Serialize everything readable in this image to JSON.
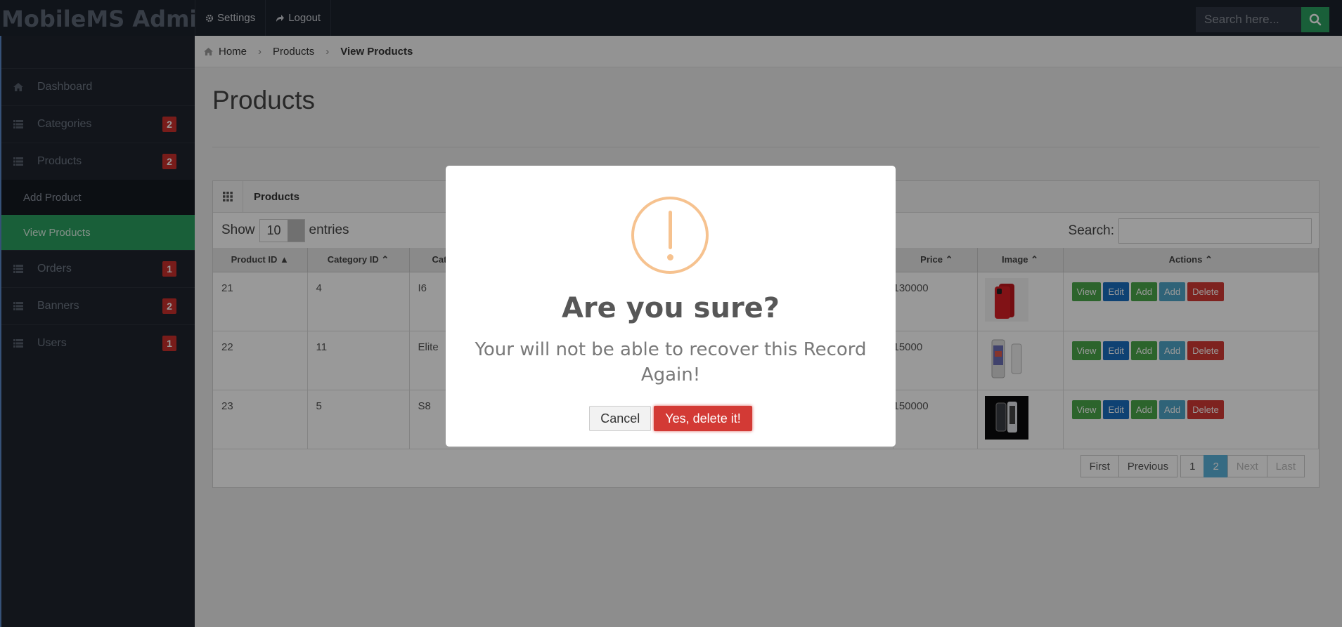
{
  "header": {
    "brand": "MobileMS Admin",
    "settings": "Settings",
    "logout": "Logout",
    "search_placeholder": "Search here..."
  },
  "sidebar": {
    "items": [
      {
        "label": "Dashboard"
      },
      {
        "label": "Categories",
        "badge": "2"
      },
      {
        "label": "Products",
        "badge": "2"
      },
      {
        "label": "Orders",
        "badge": "1"
      },
      {
        "label": "Banners",
        "badge": "2"
      },
      {
        "label": "Users",
        "badge": "1"
      }
    ],
    "subitems": [
      "Add Product",
      "View Products"
    ]
  },
  "breadcrumb": [
    "Home",
    "Products",
    "View Products"
  ],
  "page": {
    "title": "Products",
    "panel_title": "Products",
    "show_label": "Show",
    "show_value": "10",
    "entries_label": "entries",
    "search_label": "Search:"
  },
  "table": {
    "columns": [
      "Product ID",
      "Category ID",
      "Cat",
      "Price",
      "Image",
      "Actions"
    ],
    "rows": [
      {
        "id": "21",
        "cat_id": "4",
        "cat": "I6",
        "price": "130000"
      },
      {
        "id": "22",
        "cat_id": "11",
        "cat": "Elite",
        "price": "15000"
      },
      {
        "id": "23",
        "cat_id": "5",
        "cat": "S8",
        "price": "150000"
      }
    ],
    "actions": [
      "View",
      "Edit",
      "Add",
      "Add",
      "Delete"
    ]
  },
  "pagination": [
    "First",
    "Previous",
    "1",
    "2",
    "Next",
    "Last"
  ],
  "dialog": {
    "title": "Are you sure?",
    "text": "Your will not be able to recover this Record Again!",
    "cancel": "Cancel",
    "confirm": "Yes, delete it!"
  },
  "colors": {
    "topbar": "#1c222c",
    "sidebar": "#1f242d",
    "active": "#2a9f5f",
    "danger": "#d33a35",
    "warning": "#f6c28f"
  }
}
